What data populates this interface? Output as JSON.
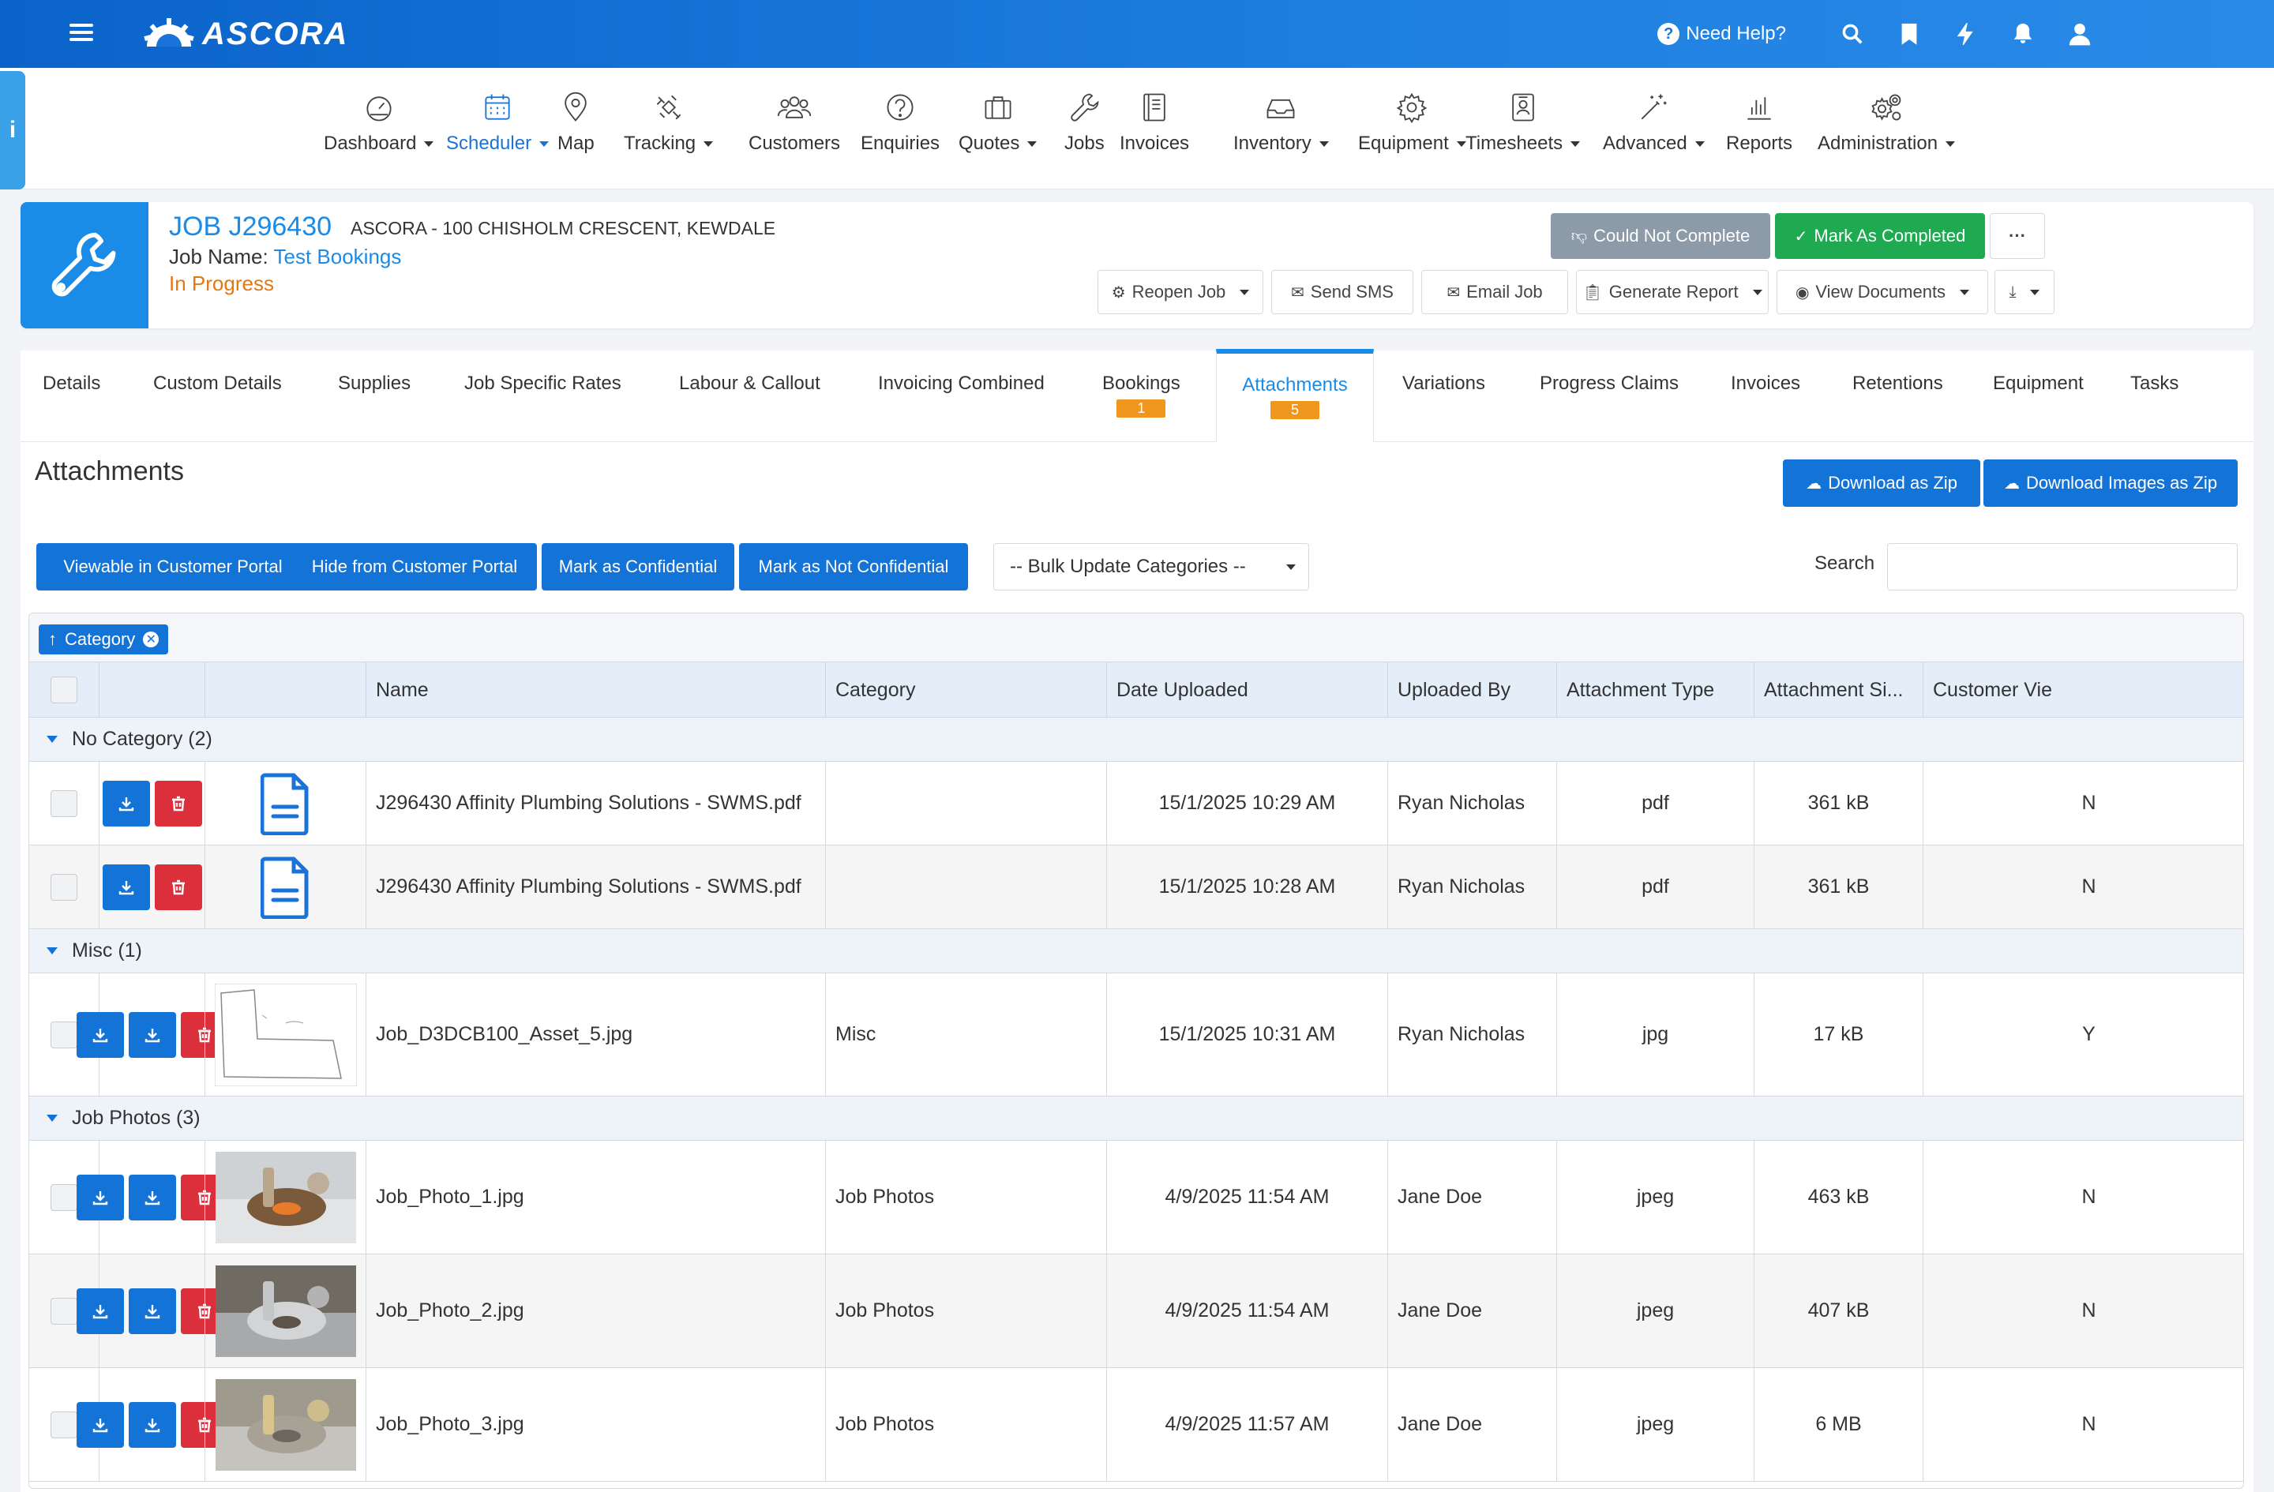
{
  "app": {
    "brand": "ASCORA",
    "help_label": "Need Help?",
    "info_tab": "i"
  },
  "nav": [
    {
      "label": "Dashboard",
      "icon": "gauge-icon",
      "dropdown": true
    },
    {
      "label": "Scheduler",
      "icon": "calendar-icon",
      "dropdown": true,
      "active": true
    },
    {
      "label": "Map",
      "icon": "map-pin-icon",
      "dropdown": false
    },
    {
      "label": "Tracking",
      "icon": "satellite-icon",
      "dropdown": true
    },
    {
      "label": "Customers",
      "icon": "users-icon",
      "dropdown": false
    },
    {
      "label": "Enquiries",
      "icon": "question-icon",
      "dropdown": false
    },
    {
      "label": "Quotes",
      "icon": "briefcase-icon",
      "dropdown": true
    },
    {
      "label": "Jobs",
      "icon": "wrench-icon",
      "dropdown": false
    },
    {
      "label": "Invoices",
      "icon": "book-icon",
      "dropdown": false
    },
    {
      "label": "Inventory",
      "icon": "inbox-icon",
      "dropdown": true
    },
    {
      "label": "Equipment",
      "icon": "gear-icon",
      "dropdown": true
    },
    {
      "label": "Timesheets",
      "icon": "timesheet-icon",
      "dropdown": true
    },
    {
      "label": "Advanced",
      "icon": "magic-wand-icon",
      "dropdown": true
    },
    {
      "label": "Reports",
      "icon": "bar-chart-icon",
      "dropdown": false
    },
    {
      "label": "Administration",
      "icon": "gears-icon",
      "dropdown": true
    }
  ],
  "job": {
    "id": "JOB J296430",
    "address": "Ascora - 100 Chisholm Crescent, Kewdale",
    "name_label": "Job Name:",
    "name_value": "Test Bookings",
    "status": "In Progress",
    "actions": {
      "could_not_complete": "Could Not Complete",
      "mark_completed": "Mark As Completed",
      "more": "···",
      "reopen": "Reopen Job",
      "send_sms": "Send SMS",
      "email_job": "Email Job",
      "generate_report": "Generate Report",
      "view_documents": "View Documents"
    }
  },
  "tabs": [
    {
      "label": "Details"
    },
    {
      "label": "Custom Details"
    },
    {
      "label": "Supplies"
    },
    {
      "label": "Job Specific Rates"
    },
    {
      "label": "Labour & Callout"
    },
    {
      "label": "Invoicing Combined"
    },
    {
      "label": "Bookings",
      "badge": "1"
    },
    {
      "label": "Attachments",
      "badge": "5",
      "active": true
    },
    {
      "label": "Variations"
    },
    {
      "label": "Progress Claims"
    },
    {
      "label": "Invoices"
    },
    {
      "label": "Retentions"
    },
    {
      "label": "Equipment"
    },
    {
      "label": "Tasks"
    }
  ],
  "attachments": {
    "title": "Attachments",
    "download_zip": "Download as Zip",
    "download_images_zip": "Download Images as Zip",
    "bulk": {
      "viewable": "Viewable in Customer Portal",
      "hide": "Hide from Customer Portal",
      "confidential": "Mark as Confidential",
      "not_confidential": "Mark as Not Confidential"
    },
    "bulk_category_select": "-- Bulk Update Categories --",
    "search_label": "Search",
    "search_value": "",
    "group_chip": "Category",
    "columns": [
      "Name",
      "Category",
      "Date Uploaded",
      "Uploaded By",
      "Attachment Type",
      "Attachment Si...",
      "Customer Vie"
    ],
    "groups": [
      {
        "label": "No Category (2)",
        "rows": [
          {
            "name": "J296430 Affinity Plumbing Solutions - SWMS.pdf",
            "category": "",
            "date": "15/1/2025 10:29 AM",
            "by": "Ryan Nicholas",
            "type": "pdf",
            "size": "361 kB",
            "customer": "N",
            "thumb": "pdf"
          },
          {
            "name": "J296430 Affinity Plumbing Solutions - SWMS.pdf",
            "category": "",
            "date": "15/1/2025 10:28 AM",
            "by": "Ryan Nicholas",
            "type": "pdf",
            "size": "361 kB",
            "customer": "N",
            "thumb": "pdf"
          }
        ]
      },
      {
        "label": "Misc (1)",
        "rows": [
          {
            "name": "Job_D3DCB100_Asset_5.jpg",
            "category": "Misc",
            "date": "15/1/2025 10:31 AM",
            "by": "Ryan Nicholas",
            "type": "jpg",
            "size": "17 kB",
            "customer": "Y",
            "thumb": "sketch"
          }
        ]
      },
      {
        "label": "Job Photos (3)",
        "rows": [
          {
            "name": "Job_Photo_1.jpg",
            "category": "Job Photos",
            "date": "4/9/2025 11:54 AM",
            "by": "Jane Doe",
            "type": "jpeg",
            "size": "463 kB",
            "customer": "N",
            "thumb": "photo1"
          },
          {
            "name": "Job_Photo_2.jpg",
            "category": "Job Photos",
            "date": "4/9/2025 11:54 AM",
            "by": "Jane Doe",
            "type": "jpeg",
            "size": "407 kB",
            "customer": "N",
            "thumb": "photo2"
          },
          {
            "name": "Job_Photo_3.jpg",
            "category": "Job Photos",
            "date": "4/9/2025 11:57 AM",
            "by": "Jane Doe",
            "type": "jpeg",
            "size": "6 MB",
            "customer": "N",
            "thumb": "photo3"
          }
        ]
      }
    ]
  },
  "colors": {
    "primary": "#1473d6",
    "accent": "#1a8be6",
    "success": "#1faa52",
    "danger": "#dc2f3c",
    "status": "#e5770f",
    "badge": "#f0961c"
  }
}
